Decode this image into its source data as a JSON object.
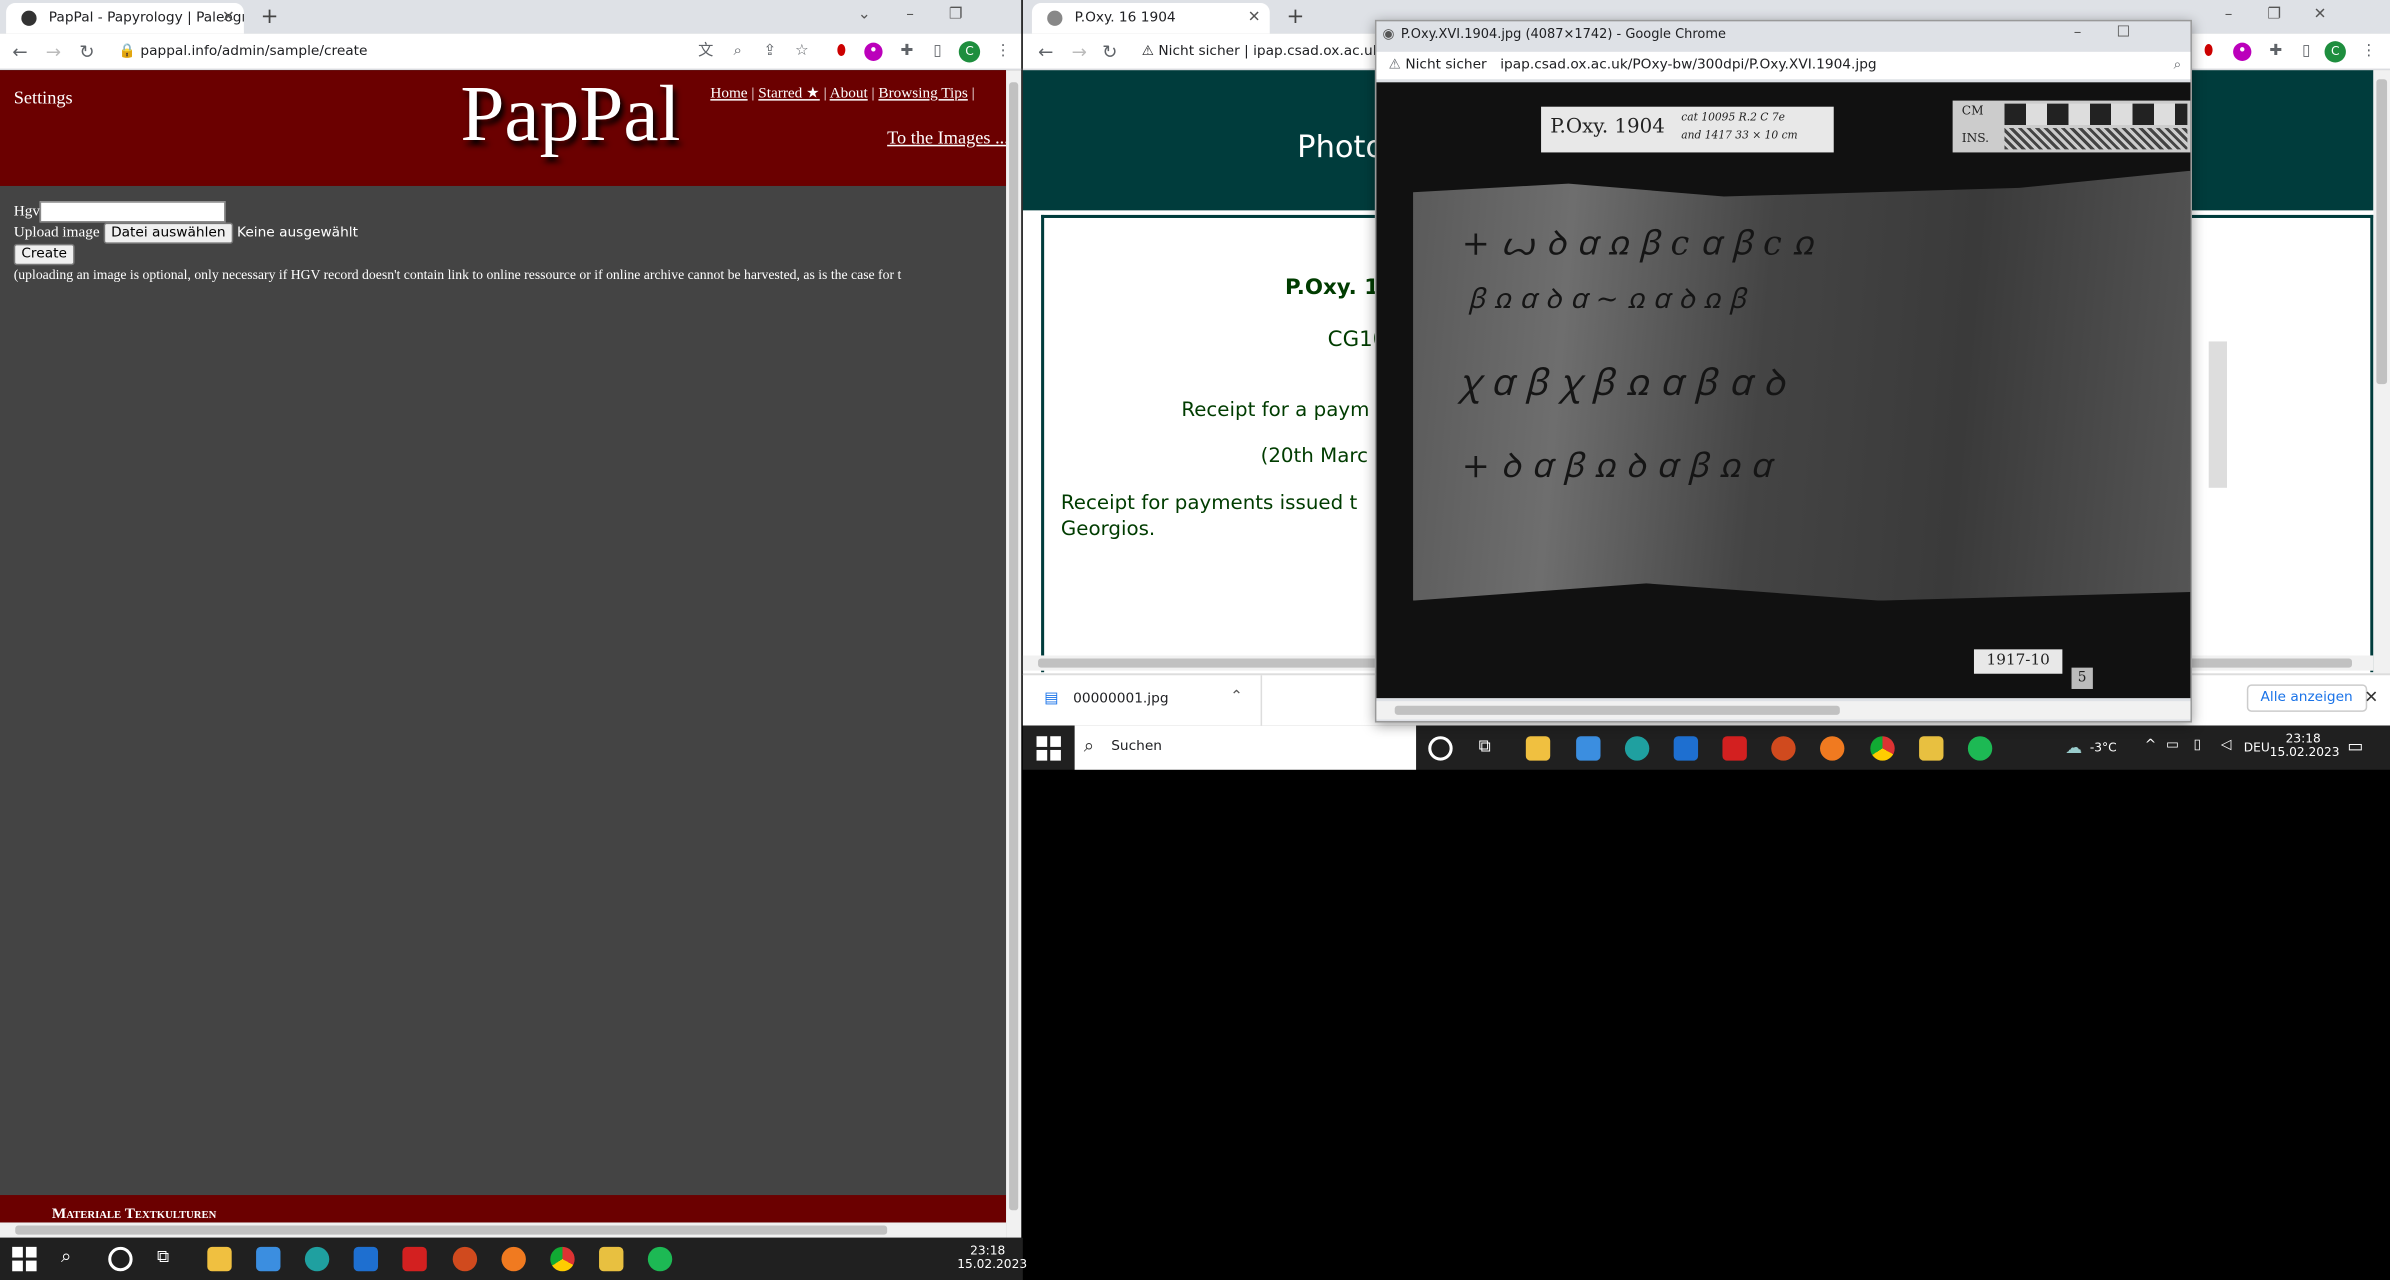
{
  "left_window": {
    "tab_title": "PapPal - Papyrology | Paleograph...",
    "url": "pappal.info/admin/sample/create",
    "page": {
      "settings_label": "Settings",
      "logo": "PapPal",
      "nav": [
        "Home",
        "Starred ★",
        "About",
        "Browsing Tips"
      ],
      "to_images": "To the Images ...",
      "form": {
        "hgv_label": "Hgv",
        "upload_label": "Upload image",
        "file_button": "Datei auswählen",
        "file_status": "Keine ausgewählt",
        "create_button": "Create",
        "note": "(uploading an image is optional, only necessary if HGV record doesn't contain link to online ressource or if online archive cannot be harvested, as is the case for t"
      },
      "footer": "Materiale Textkulturen"
    }
  },
  "right_window": {
    "tab_title": "P.Oxy. 16 1904",
    "security": "Nicht sicher",
    "url": "ipap.csad.ox.ac.uk/",
    "page": {
      "banner_title": "Photo",
      "record_title": "P.Oxy. 1",
      "catalog": "CG10",
      "summary": "Receipt for a paym",
      "date": "(20th Marc",
      "description": "Receipt for payments issued t Georgios."
    }
  },
  "popup": {
    "title": "P.Oxy.XVI.1904.jpg (4087×1742) - Google Chrome",
    "security": "Nicht sicher",
    "url": "ipap.csad.ox.ac.uk/POxy-bw/300dpi/P.Oxy.XVI.1904.jpg",
    "image": {
      "label_main": "P.Oxy. 1904",
      "label_note_1": "cat 10095 R.2 C 7e",
      "label_note_2": "and 1417  33 × 10 cm",
      "scale_cm": "CM",
      "scale_ins": "INS.",
      "bottom_tag": "1917-10",
      "bottom_num": "5"
    }
  },
  "downloads": {
    "file": "00000001.jpg",
    "show_all": "Alle anzeigen"
  },
  "taskbar_right": {
    "search": "Suchen",
    "weather": "-3°C",
    "lang": "DEU",
    "time": "23:18",
    "date": "15.02.2023"
  },
  "taskbar_left": {
    "time": "23:18",
    "date": "15.02.2023"
  },
  "colors": {
    "pappal_red": "#6b0000",
    "pappal_bg": "#444444",
    "ipap_green": "#003c3c"
  }
}
